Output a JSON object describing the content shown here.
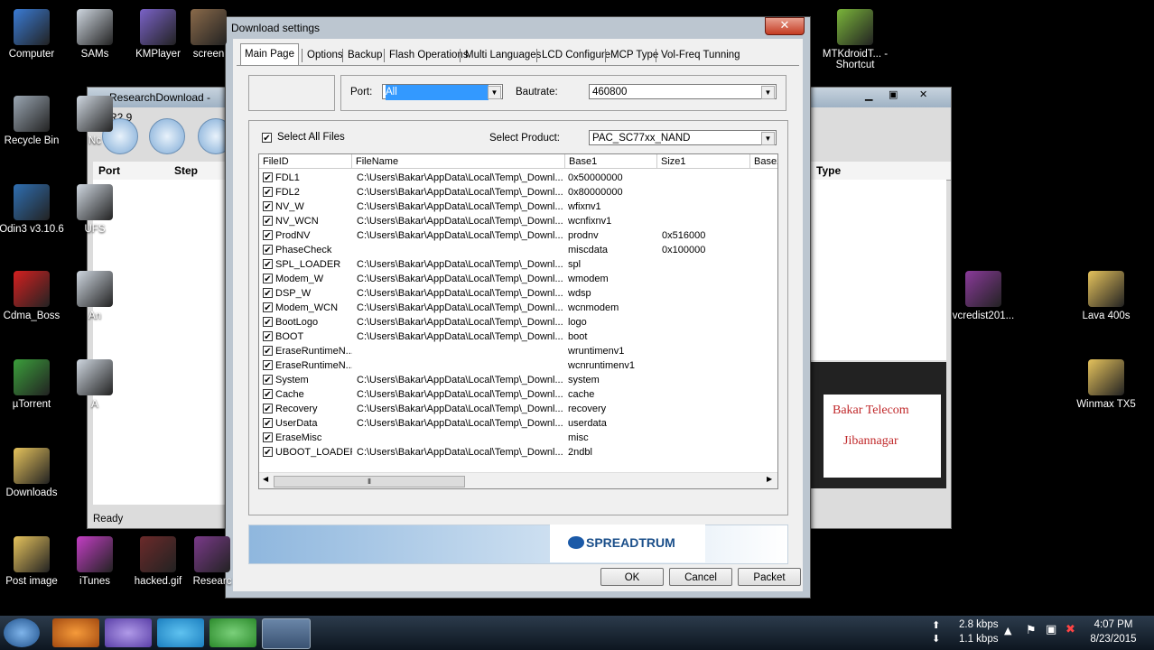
{
  "desktop_left": [
    {
      "label": "Computer",
      "color": "#3a7bd5"
    },
    {
      "label": "Recycle Bin",
      "color": "#9aa6b2"
    },
    {
      "label": "Odin3 v3.10.6",
      "color": "#2f6fb2"
    },
    {
      "label": "Cdma_Boss",
      "color": "#d52020"
    },
    {
      "label": "µTorrent",
      "color": "#3b9f3b"
    },
    {
      "label": "Downloads",
      "color": "#e6c35c"
    },
    {
      "label": "Post image",
      "color": "#e6c35c"
    }
  ],
  "desktop_col2": [
    {
      "label": "SAMs",
      "color": "#cfd7e0"
    },
    {
      "label": "Nc",
      "color": "#cfd7e0"
    },
    {
      "label": "UFS",
      "color": "#cfd7e0"
    },
    {
      "label": "An",
      "color": "#cfd7e0"
    },
    {
      "label": "A",
      "color": "#cfd7e0"
    },
    {
      "label": "iTunes",
      "color": "#c33ec4"
    }
  ],
  "desktop_top": [
    {
      "label": "KMPlayer",
      "color": "#7a62c8"
    },
    {
      "label": "screen",
      "color": "#8a6a4a"
    }
  ],
  "desktop_bottom": [
    {
      "label": "hacked.gif",
      "color": "#6b2a2a"
    },
    {
      "label": "Researc",
      "color": "#7a3a8a"
    }
  ],
  "desktop_right": [
    {
      "label": "MTKdroidT... - Shortcut",
      "color": "#7ab53a"
    },
    {
      "label": "vcredist201...",
      "color": "#8a3a9a"
    },
    {
      "label": "Lava 400s",
      "color": "#e6c35c"
    },
    {
      "label": "Winmax TX5",
      "color": "#e6c35c"
    }
  ],
  "background_window": {
    "title": "ResearchDownload - R2.9",
    "col_port": "Port",
    "col_step": "Step",
    "col_type": "Type",
    "status": "Ready",
    "watermark_line1": "Bakar Telecom",
    "watermark_line2": "Jibannagar"
  },
  "dialog": {
    "title": "Download settings",
    "close": "✕",
    "tabs": [
      "Main Page",
      "Options",
      "Backup",
      "Flash Operations",
      "Multi Languages",
      "LCD Configure",
      "MCP Type",
      "Vol-Freq Tunning"
    ],
    "port_label": "Port:",
    "port_value": "All",
    "baudrate_label": "Bautrate:",
    "baudrate_value": "460800",
    "select_all_label": "Select All Files",
    "select_product_label": "Select Product:",
    "product_value": "PAC_SC77xx_NAND",
    "columns": [
      "FileID",
      "FileName",
      "Base1",
      "Size1",
      "Base2"
    ],
    "rows": [
      {
        "id": "FDL1",
        "file": "C:\\Users\\Bakar\\AppData\\Local\\Temp\\_Downl...",
        "base": "0x50000000",
        "size": ""
      },
      {
        "id": "FDL2",
        "file": "C:\\Users\\Bakar\\AppData\\Local\\Temp\\_Downl...",
        "base": "0x80000000",
        "size": ""
      },
      {
        "id": "NV_W",
        "file": "C:\\Users\\Bakar\\AppData\\Local\\Temp\\_Downl...",
        "base": "wfixnv1",
        "size": ""
      },
      {
        "id": "NV_WCN",
        "file": "C:\\Users\\Bakar\\AppData\\Local\\Temp\\_Downl...",
        "base": "wcnfixnv1",
        "size": ""
      },
      {
        "id": "ProdNV",
        "file": "C:\\Users\\Bakar\\AppData\\Local\\Temp\\_Downl...",
        "base": "prodnv",
        "size": "0x516000"
      },
      {
        "id": "PhaseCheck",
        "file": "",
        "base": "miscdata",
        "size": "0x100000"
      },
      {
        "id": "SPL_LOADER",
        "file": "C:\\Users\\Bakar\\AppData\\Local\\Temp\\_Downl...",
        "base": "spl",
        "size": ""
      },
      {
        "id": "Modem_W",
        "file": "C:\\Users\\Bakar\\AppData\\Local\\Temp\\_Downl...",
        "base": "wmodem",
        "size": ""
      },
      {
        "id": "DSP_W",
        "file": "C:\\Users\\Bakar\\AppData\\Local\\Temp\\_Downl...",
        "base": "wdsp",
        "size": ""
      },
      {
        "id": "Modem_WCN",
        "file": "C:\\Users\\Bakar\\AppData\\Local\\Temp\\_Downl...",
        "base": "wcnmodem",
        "size": ""
      },
      {
        "id": "BootLogo",
        "file": "C:\\Users\\Bakar\\AppData\\Local\\Temp\\_Downl...",
        "base": "logo",
        "size": ""
      },
      {
        "id": "BOOT",
        "file": "C:\\Users\\Bakar\\AppData\\Local\\Temp\\_Downl...",
        "base": "boot",
        "size": ""
      },
      {
        "id": "EraseRuntimeN...",
        "file": "",
        "base": "wruntimenv1",
        "size": ""
      },
      {
        "id": "EraseRuntimeN...",
        "file": "",
        "base": "wcnruntimenv1",
        "size": ""
      },
      {
        "id": "System",
        "file": "C:\\Users\\Bakar\\AppData\\Local\\Temp\\_Downl...",
        "base": "system",
        "size": ""
      },
      {
        "id": "Cache",
        "file": "C:\\Users\\Bakar\\AppData\\Local\\Temp\\_Downl...",
        "base": "cache",
        "size": ""
      },
      {
        "id": "Recovery",
        "file": "C:\\Users\\Bakar\\AppData\\Local\\Temp\\_Downl...",
        "base": "recovery",
        "size": ""
      },
      {
        "id": "UserData",
        "file": "C:\\Users\\Bakar\\AppData\\Local\\Temp\\_Downl...",
        "base": "userdata",
        "size": ""
      },
      {
        "id": "EraseMisc",
        "file": "",
        "base": "misc",
        "size": ""
      },
      {
        "id": "UBOOT_LOADER",
        "file": "C:\\Users\\Bakar\\AppData\\Local\\Temp\\_Downl...",
        "base": "2ndbl",
        "size": ""
      }
    ],
    "scroll_grip": "⦀",
    "logo_text": "SPREADTRUM",
    "ok": "OK",
    "cancel": "Cancel",
    "packet": "Packet"
  },
  "taskbar": {
    "net_up": "2.8 kbps",
    "net_down": "1.1 kbps",
    "time": "4:07 PM",
    "date": "8/23/2015"
  }
}
